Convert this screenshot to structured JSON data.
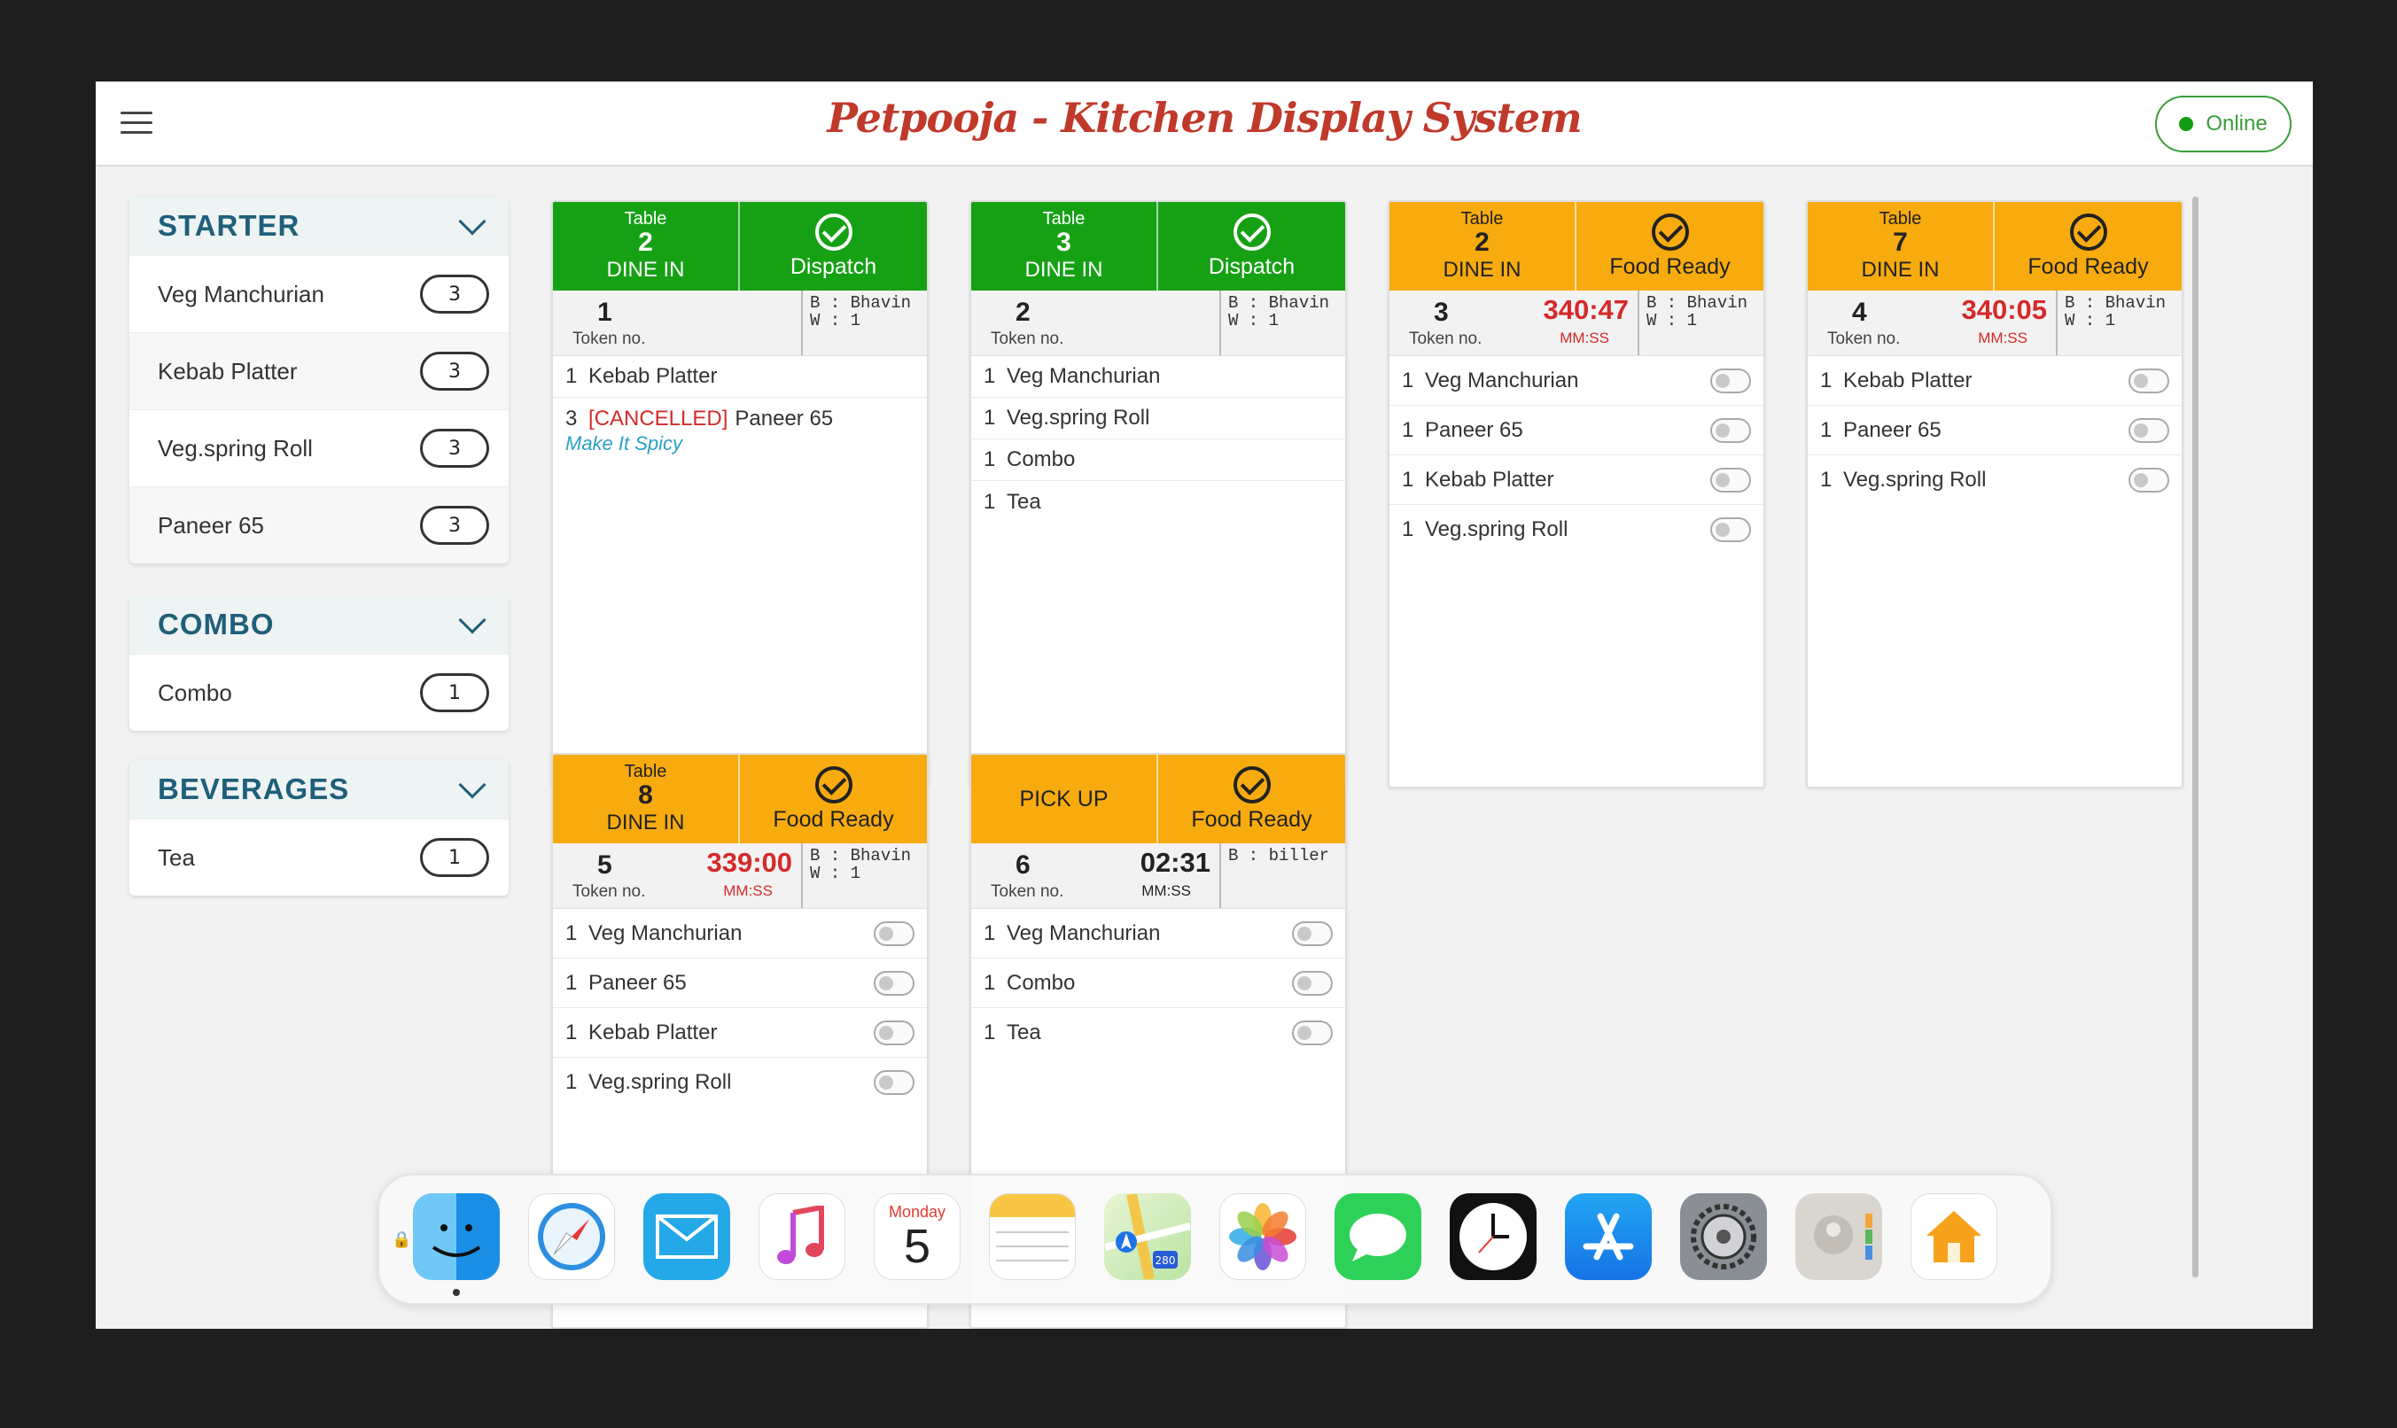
{
  "header": {
    "title": "Petpooja - Kitchen Display System",
    "status": "Online"
  },
  "sidebar": [
    {
      "title": "STARTER",
      "items": [
        {
          "label": "Veg Manchurian",
          "count": "3"
        },
        {
          "label": "Kebab Platter",
          "count": "3"
        },
        {
          "label": "Veg.spring Roll",
          "count": "3"
        },
        {
          "label": "Paneer 65",
          "count": "3"
        }
      ]
    },
    {
      "title": "COMBO",
      "items": [
        {
          "label": "Combo",
          "count": "1"
        }
      ]
    },
    {
      "title": "BEVERAGES",
      "items": [
        {
          "label": "Tea",
          "count": "1"
        }
      ]
    }
  ],
  "orders": [
    {
      "table_word": "Table",
      "table": "2",
      "type": "DINE IN",
      "status": "Dispatch",
      "token": "1",
      "token_label": "Token no.",
      "biller": "B : Bhavin",
      "waiter": "W : 1",
      "items": [
        {
          "qty": "1",
          "name": "Kebab Platter"
        },
        {
          "qty": "3",
          "cancelled": "[CANCELLED]",
          "name": "Paneer 65",
          "note": "Make It Spicy"
        }
      ]
    },
    {
      "table_word": "Table",
      "table": "3",
      "type": "DINE IN",
      "status": "Dispatch",
      "token": "2",
      "token_label": "Token no.",
      "biller": "B : Bhavin",
      "waiter": "W : 1",
      "items": [
        {
          "qty": "1",
          "name": "Veg Manchurian"
        },
        {
          "qty": "1",
          "name": "Veg.spring Roll"
        },
        {
          "qty": "1",
          "name": "Combo"
        },
        {
          "qty": "1",
          "name": "Tea"
        }
      ]
    },
    {
      "table_word": "Table",
      "table": "2",
      "type": "DINE IN",
      "status": "Food Ready",
      "token": "3",
      "token_label": "Token no.",
      "timer": "340:47",
      "timer_label": "MM:SS",
      "biller": "B : Bhavin",
      "waiter": "W : 1",
      "items": [
        {
          "qty": "1",
          "name": "Veg Manchurian"
        },
        {
          "qty": "1",
          "name": "Paneer 65"
        },
        {
          "qty": "1",
          "name": "Kebab Platter"
        },
        {
          "qty": "1",
          "name": "Veg.spring Roll"
        }
      ]
    },
    {
      "table_word": "Table",
      "table": "7",
      "type": "DINE IN",
      "status": "Food Ready",
      "token": "4",
      "token_label": "Token no.",
      "timer": "340:05",
      "timer_label": "MM:SS",
      "biller": "B : Bhavin",
      "waiter": "W : 1",
      "items": [
        {
          "qty": "1",
          "name": "Kebab Platter"
        },
        {
          "qty": "1",
          "name": "Paneer 65"
        },
        {
          "qty": "1",
          "name": "Veg.spring Roll"
        }
      ]
    },
    {
      "table_word": "Table",
      "table": "8",
      "type": "DINE IN",
      "status": "Food Ready",
      "token": "5",
      "token_label": "Token no.",
      "timer": "339:00",
      "timer_label": "MM:SS",
      "biller": "B : Bhavin",
      "waiter": "W : 1",
      "items": [
        {
          "qty": "1",
          "name": "Veg Manchurian"
        },
        {
          "qty": "1",
          "name": "Paneer 65"
        },
        {
          "qty": "1",
          "name": "Kebab Platter"
        },
        {
          "qty": "1",
          "name": "Veg.spring Roll"
        }
      ]
    },
    {
      "pickup": "PICK UP",
      "status": "Food Ready",
      "token": "6",
      "token_label": "Token no.",
      "timer": "02:31",
      "timer_label": "MM:SS",
      "biller": "B : biller",
      "items": [
        {
          "qty": "1",
          "name": "Veg Manchurian"
        },
        {
          "qty": "1",
          "name": "Combo"
        },
        {
          "qty": "1",
          "name": "Tea"
        }
      ]
    }
  ],
  "dock": {
    "icons": [
      "finder-icon",
      "safari-icon",
      "mail-icon",
      "music-icon",
      "calendar-icon",
      "notes-icon",
      "maps-icon",
      "photos-icon",
      "messages-icon",
      "clock-icon",
      "app-store-icon",
      "settings-icon",
      "contacts-icon",
      "home-icon"
    ],
    "calendar_day": "Monday",
    "calendar_date": "5",
    "maps_badge": "280"
  },
  "colors": {
    "dispatch": "#16a115",
    "food_ready": "#f7ab0f",
    "timer": "#d42a2a",
    "brand": "#c0392b"
  }
}
